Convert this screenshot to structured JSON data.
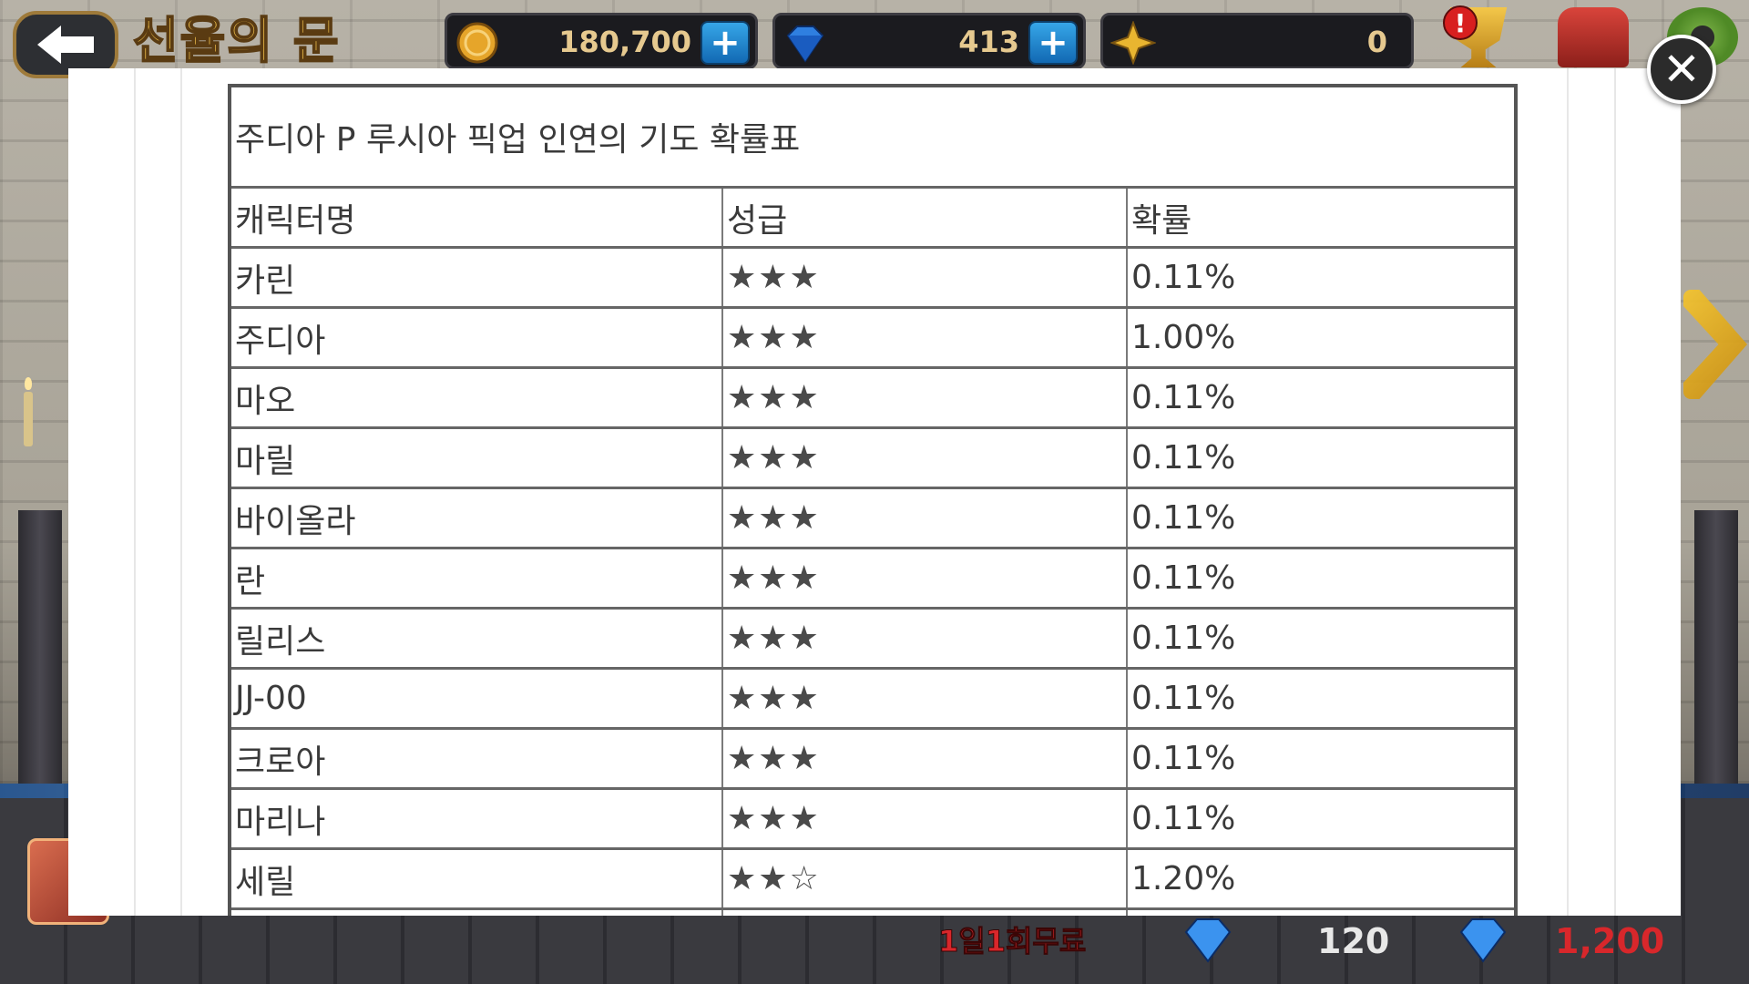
{
  "header": {
    "title": "선율의 문",
    "gold": "180,700",
    "gems": "413",
    "stars": "0"
  },
  "probability_table": {
    "title": "주디아 P 루시아 픽업 인연의 기도 확률표",
    "columns": [
      "캐릭터명",
      "성급",
      "확률"
    ],
    "rows": [
      {
        "name": "카린",
        "grade": "★★★",
        "rate": "0.11%"
      },
      {
        "name": "주디아",
        "grade": "★★★",
        "rate": "1.00%"
      },
      {
        "name": "마오",
        "grade": "★★★",
        "rate": "0.11%"
      },
      {
        "name": "마릴",
        "grade": "★★★",
        "rate": "0.11%"
      },
      {
        "name": "바이올라",
        "grade": "★★★",
        "rate": "0.11%"
      },
      {
        "name": "란",
        "grade": "★★★",
        "rate": "0.11%"
      },
      {
        "name": "릴리스",
        "grade": "★★★",
        "rate": "0.11%"
      },
      {
        "name": "JJ-00",
        "grade": "★★★",
        "rate": "0.11%"
      },
      {
        "name": "크로아",
        "grade": "★★★",
        "rate": "0.11%"
      },
      {
        "name": "마리나",
        "grade": "★★★",
        "rate": "0.11%"
      },
      {
        "name": "세릴",
        "grade": "★★☆",
        "rate": "1.20%"
      }
    ]
  },
  "close_label": "✕",
  "plus_label": "+",
  "bottom": {
    "free_label": "1일1회무료",
    "price_single": "120",
    "price_multi": "1,200"
  },
  "icons": {
    "back": "back-arrow-icon",
    "gold": "gold-coin-icon",
    "gem": "blue-gem-icon",
    "star": "gold-star-icon",
    "trophy": "trophy-icon",
    "mail": "mailbox-icon",
    "settings": "gear-icon",
    "close": "close-icon"
  },
  "colors": {
    "title_gold": "#f2c24d",
    "plus_blue": "#1e88d8",
    "price_red": "#d8272b",
    "table_border": "#555555"
  }
}
